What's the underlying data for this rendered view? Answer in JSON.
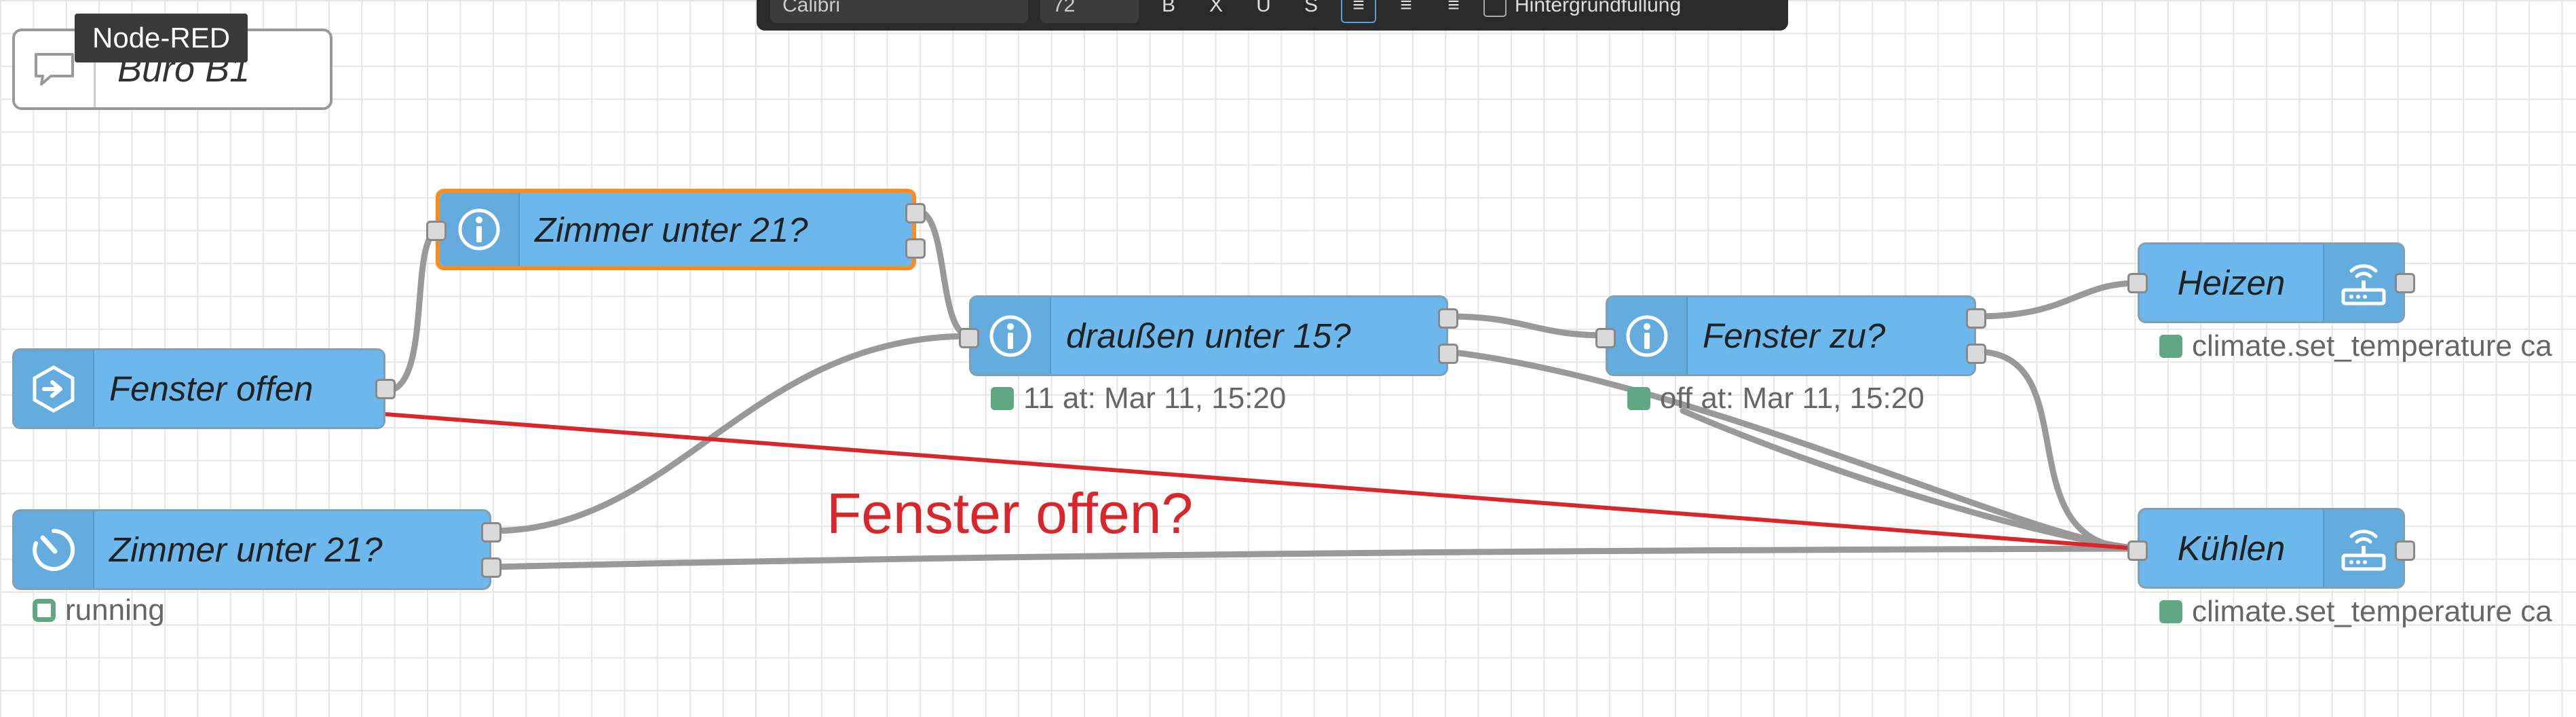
{
  "app": {
    "tooltip": "Node-RED"
  },
  "toolbar": {
    "font": "Calibri",
    "size": "72",
    "bold_label": "B",
    "italic_label": "X",
    "underline_label": "U",
    "strike_label": "S",
    "checkbox_label": "Hintergrundfüllung"
  },
  "comment": {
    "label": "Büro B1"
  },
  "annotation": {
    "text": "Fenster offen?"
  },
  "nodes": {
    "fenster_offen": {
      "label": "Fenster offen",
      "icon": "arrow-in-hexagon-icon"
    },
    "zimmer_inject": {
      "label": "Zimmer unter 21?",
      "icon": "timer-icon",
      "status": "running"
    },
    "zimmer_top": {
      "label": "Zimmer unter 21?",
      "icon": "info-icon"
    },
    "draussen": {
      "label": "draußen unter 15?",
      "icon": "info-icon",
      "status": "11 at: Mar 11, 15:20"
    },
    "fenster_zu": {
      "label": "Fenster zu?",
      "icon": "info-icon",
      "status": "off at: Mar 11, 15:20"
    },
    "heizen": {
      "label": "Heizen",
      "icon": "router-icon",
      "status": "climate.set_temperature ca"
    },
    "kuehlen": {
      "label": "Kühlen",
      "icon": "router-icon",
      "status": "climate.set_temperature ca"
    }
  },
  "colors": {
    "node_fill": "#6cb7ec",
    "selected_border": "#ff8c1a",
    "wire": "#999999",
    "annotation": "#d9262b",
    "status_dot": "#5fa883"
  }
}
